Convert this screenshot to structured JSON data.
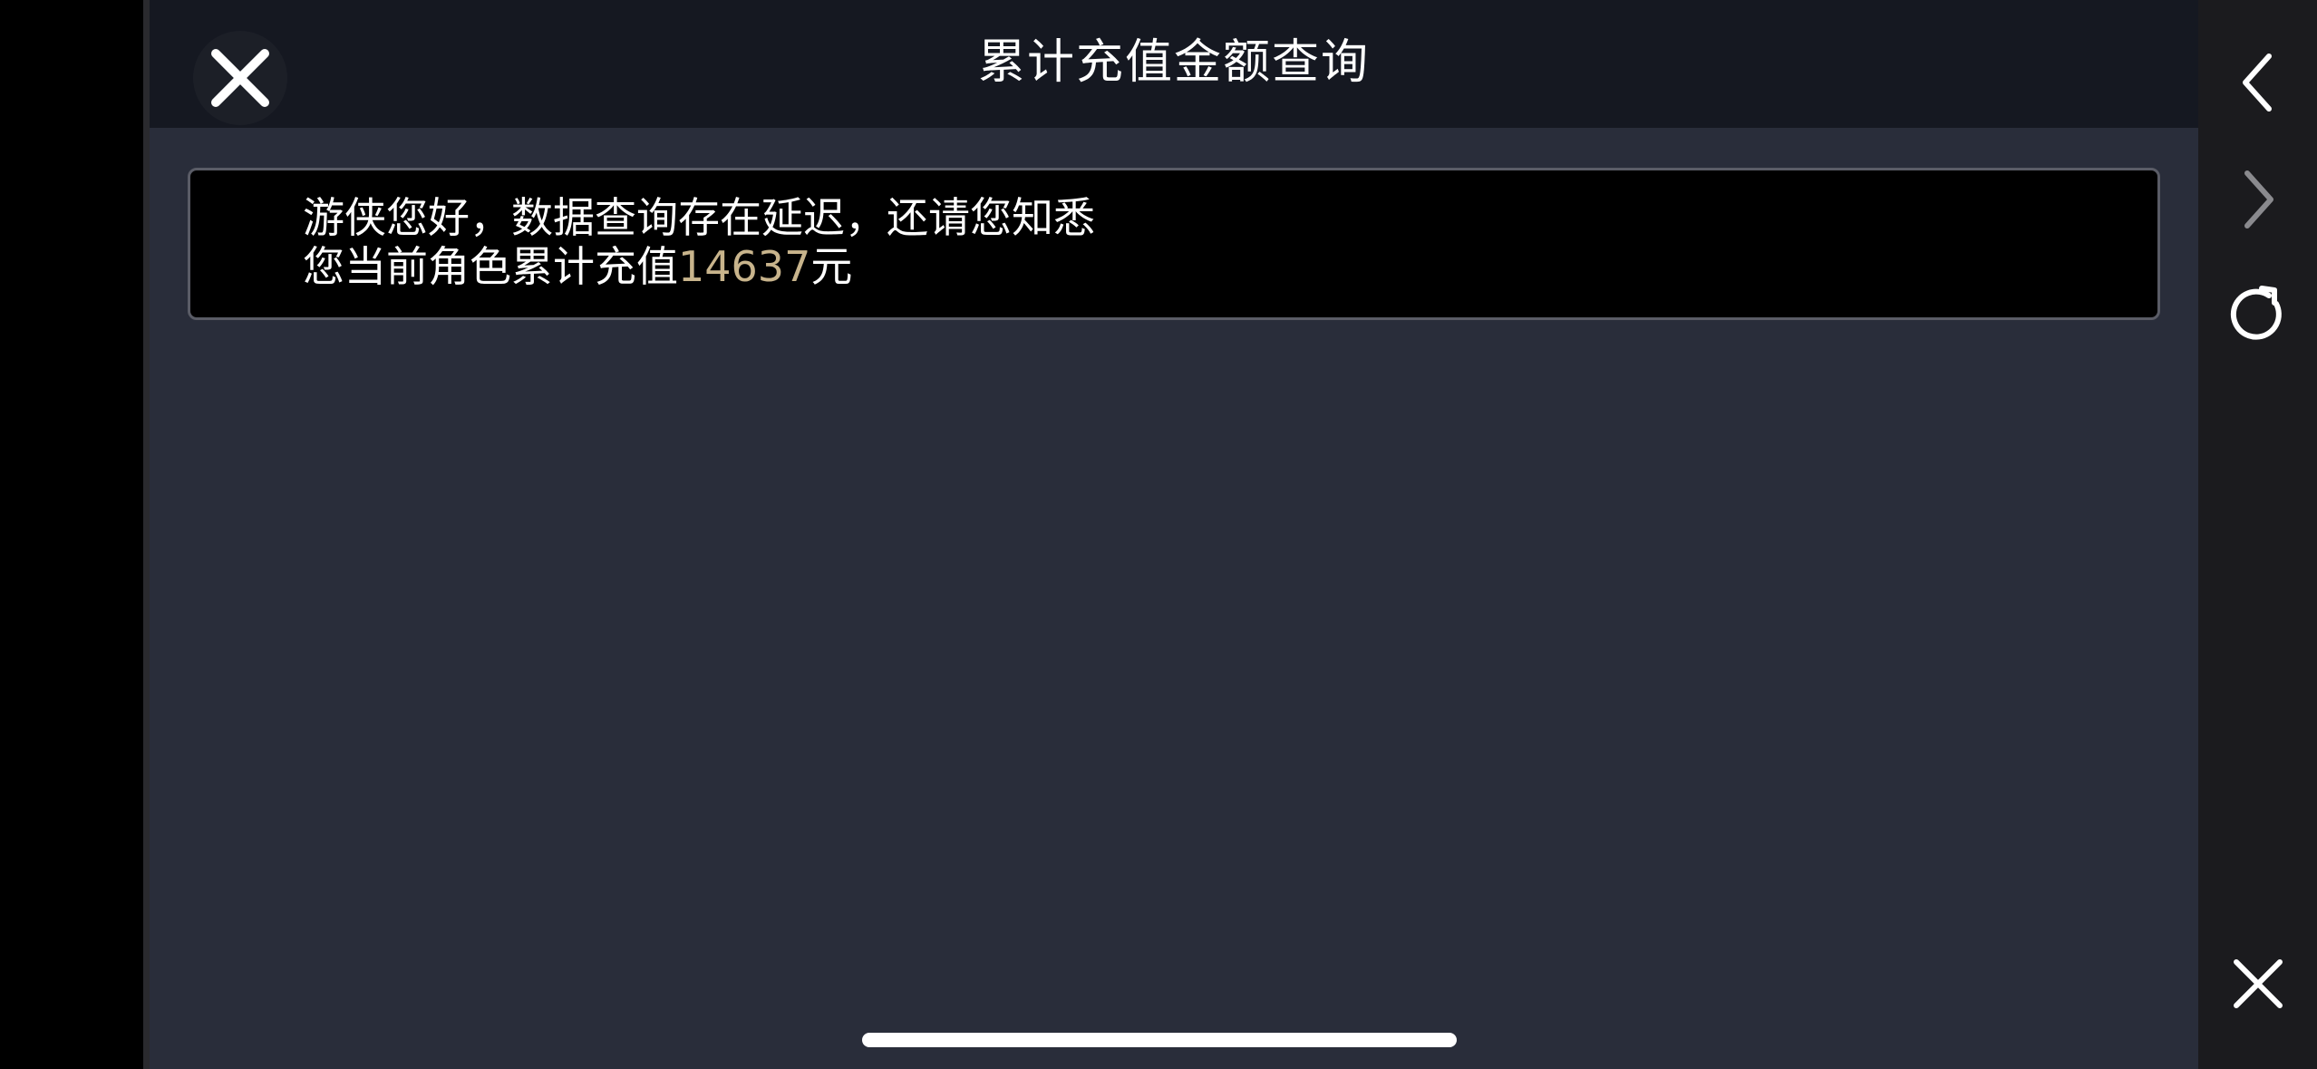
{
  "header": {
    "title": "累计充值金额查询"
  },
  "notice": {
    "line1": "游侠您好，数据查询存在延迟，还请您知悉",
    "line2_prefix": "您当前角色累计充值",
    "amount": "14637",
    "line2_suffix": "元",
    "amount_color": "#c8b48c"
  },
  "browser_controls": {
    "back_icon": "chevron-left-icon",
    "forward_icon": "chevron-right-icon",
    "refresh_icon": "refresh-icon",
    "close_icon": "close-icon"
  },
  "colors": {
    "page_background": "#292d3a",
    "header_background": "#151821",
    "side_bar_background": "#1b1b1e"
  }
}
